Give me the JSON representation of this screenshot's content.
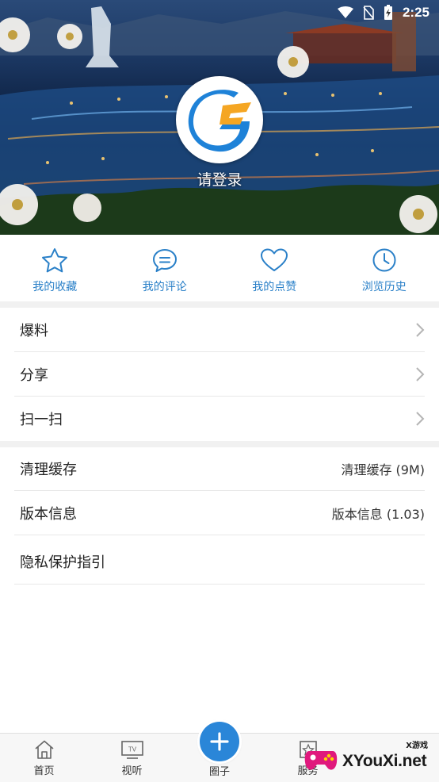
{
  "status_bar": {
    "time": "2:25",
    "icons": [
      "wifi-icon",
      "no-sim-icon",
      "battery-charging-icon"
    ]
  },
  "header": {
    "login_label": "请登录",
    "logo": "app-logo-g"
  },
  "quick_actions": [
    {
      "label": "我的收藏",
      "icon": "star-icon"
    },
    {
      "label": "我的评论",
      "icon": "comment-icon"
    },
    {
      "label": "我的点赞",
      "icon": "heart-icon"
    },
    {
      "label": "浏览历史",
      "icon": "clock-icon"
    }
  ],
  "menu_group_1": [
    {
      "label": "爆料"
    },
    {
      "label": "分享"
    },
    {
      "label": "扫一扫"
    }
  ],
  "menu_group_2": [
    {
      "label": "清理缓存",
      "value": "清理缓存 (9M)"
    },
    {
      "label": "版本信息",
      "value": "版本信息 (1.03)"
    },
    {
      "label": "隐私保护指引"
    }
  ],
  "bottom_nav": [
    {
      "label": "首页",
      "icon": "home-icon"
    },
    {
      "label": "视听",
      "icon": "tv-icon"
    },
    {
      "label": "圈子",
      "icon": "plus-icon"
    },
    {
      "label": "服务",
      "icon": "service-icon"
    }
  ],
  "watermark": {
    "text": "XYouXi.net",
    "small": "X游戏"
  },
  "colors": {
    "accent": "#2a80c8",
    "fab": "#2a86d8",
    "logo_orange": "#f5a623"
  }
}
